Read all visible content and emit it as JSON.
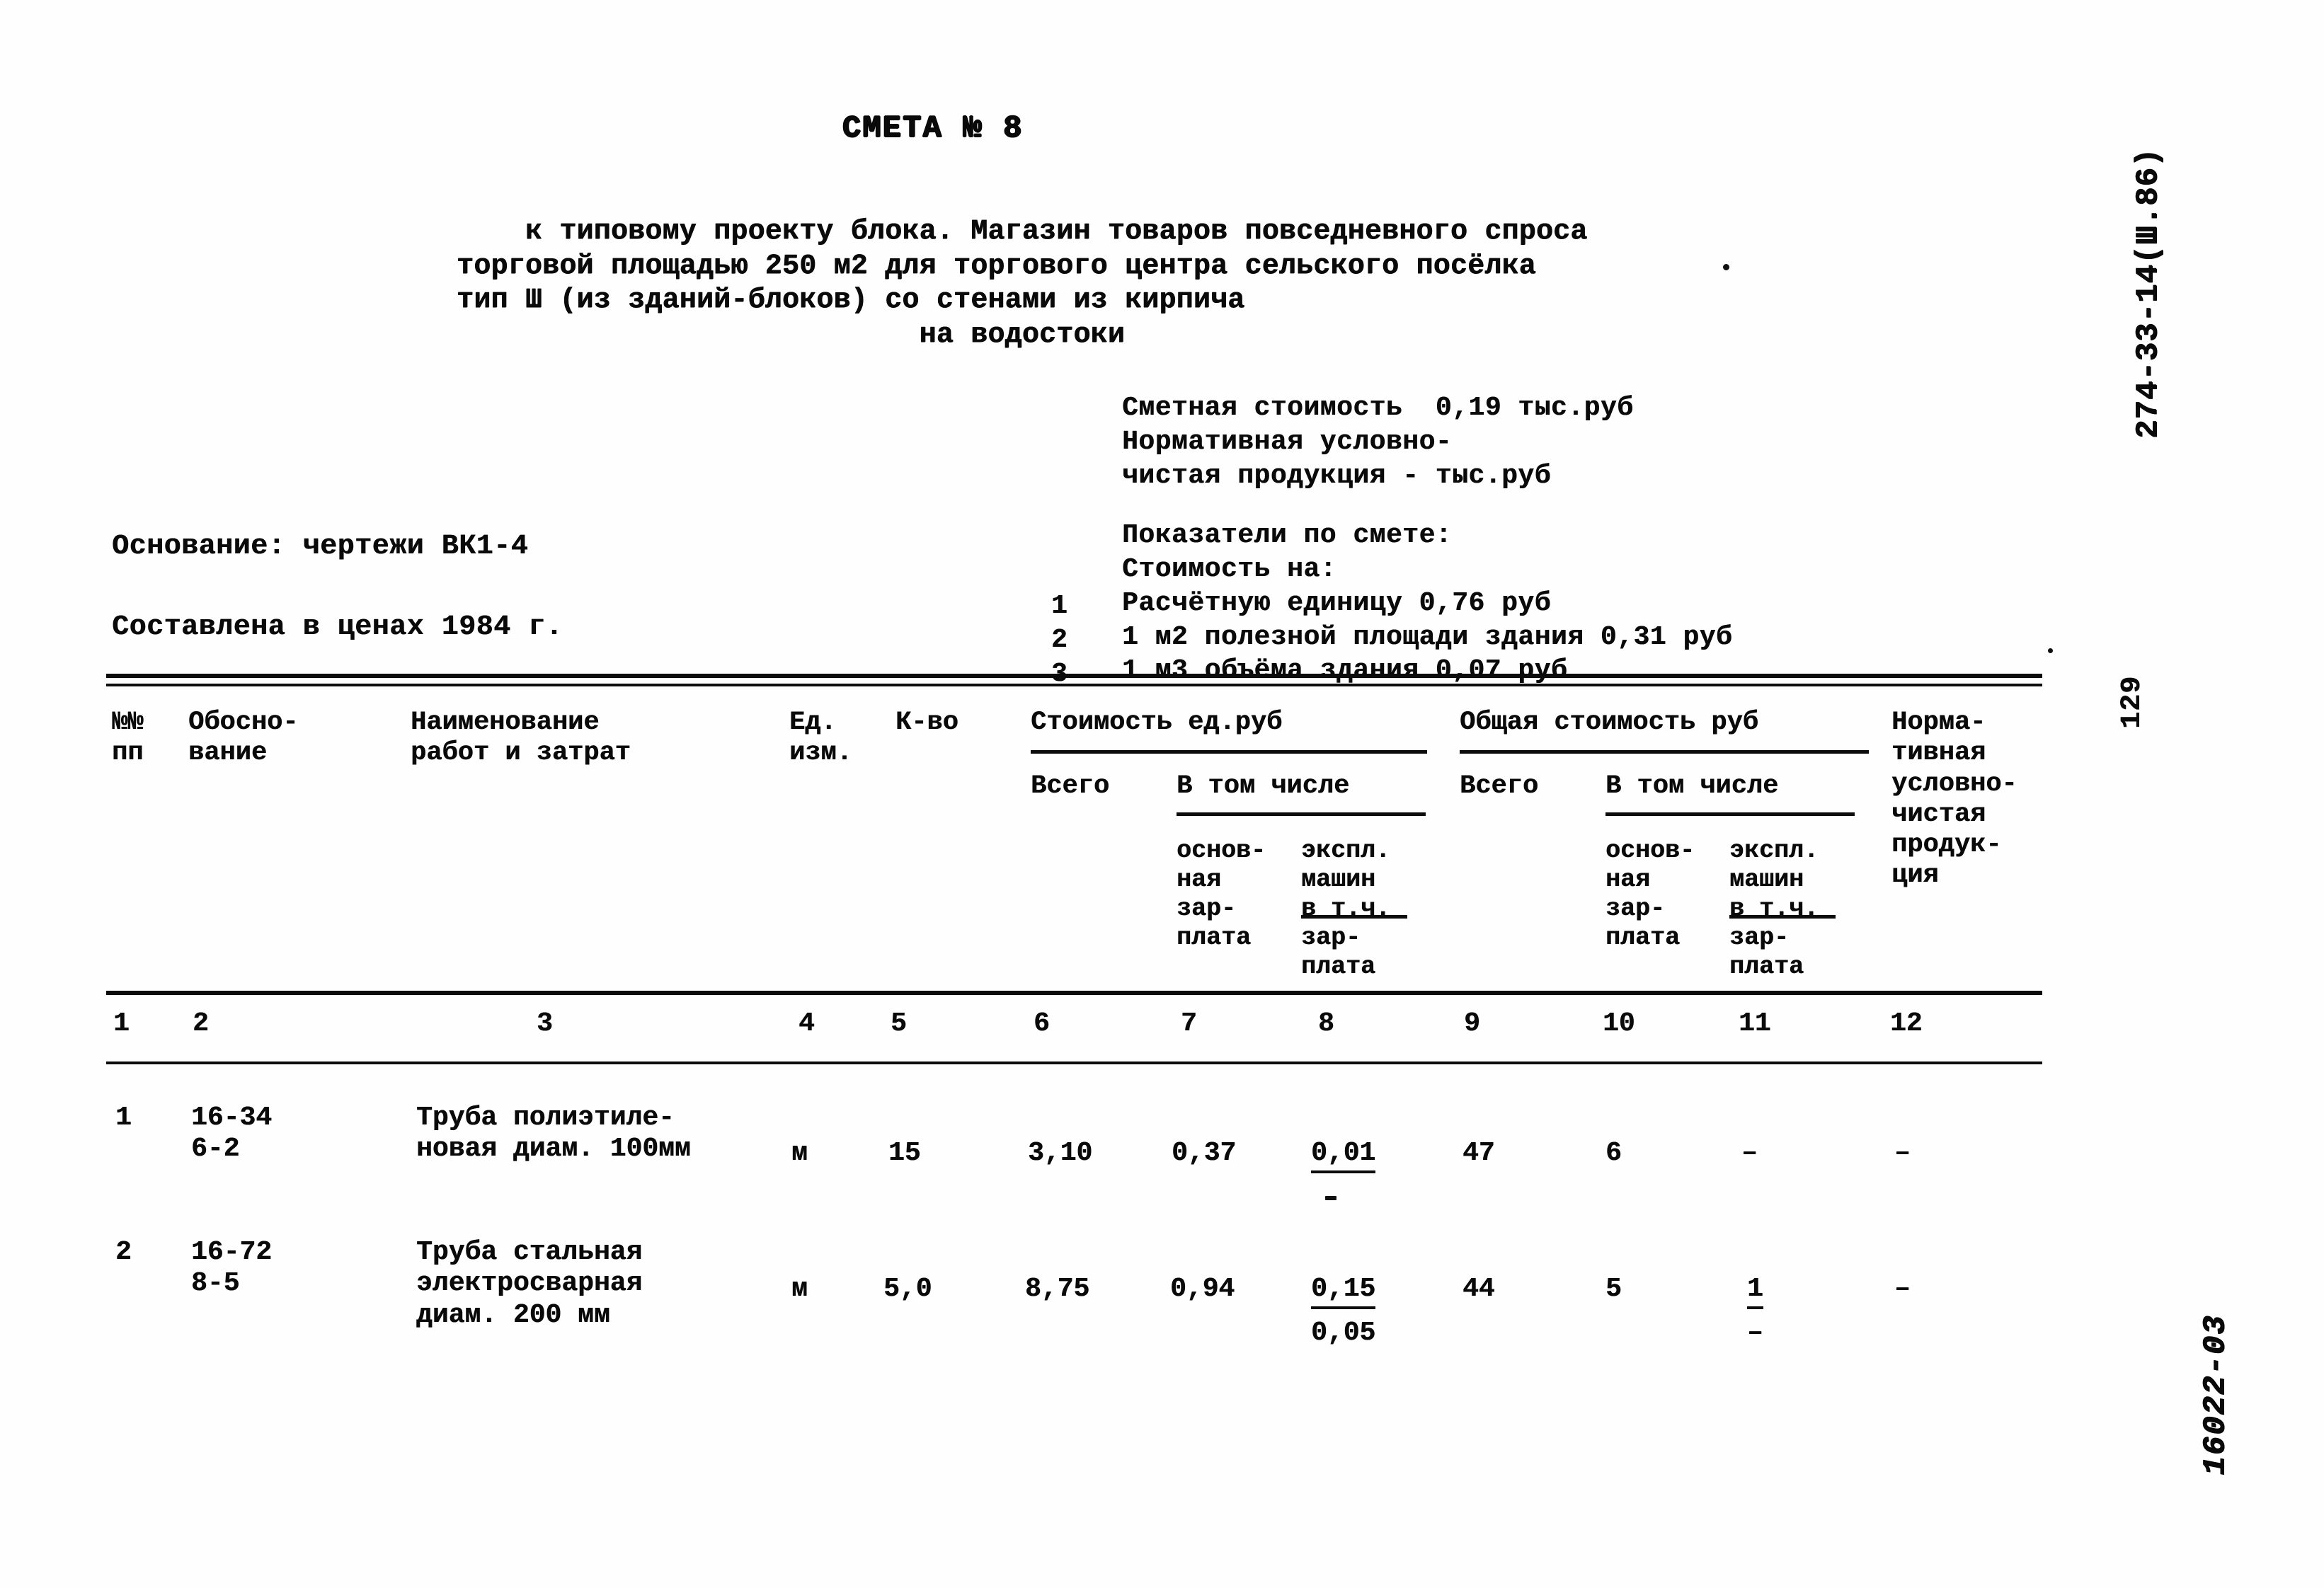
{
  "document": {
    "title": "СМЕТА № 8",
    "subtitle_lines": [
      "к типовому проекту блока. Магазин товаров повседневного спроса",
      "торговой площадью 250 м2 для торгового центра сельского посёлка",
      "тип Ш (из зданий-блоков) со стенами из кирпича"
    ],
    "subtitle_center": "на водостоки",
    "code_vertical": "274-33-14(Ш.86)",
    "page_number_vertical": "129",
    "archive_stamp_vertical": "16022-03"
  },
  "summary": {
    "estimate_cost_label": "Сметная стоимость",
    "estimate_cost_value": "0,19 тыс.руб",
    "npp_line1": "Нормативная условно-",
    "npp_line2": "чистая продукция - тыс.руб"
  },
  "indicators": {
    "heading": "Показатели по смете:",
    "subheading": "Стоимость на:",
    "items": [
      {
        "no": "1",
        "text": "Расчётную единицу 0,76 руб"
      },
      {
        "no": "2",
        "text": "1 м2 полезной площади здания 0,31 руб"
      },
      {
        "no": "3",
        "text": "1 м3 объёма здания 0,07 руб"
      }
    ]
  },
  "basis": {
    "line1": "Основание: чертежи ВК1-4",
    "line2": "Составлена в ценах 1984 г."
  },
  "table": {
    "header": {
      "col1_l1": "№№",
      "col1_l2": "пп",
      "col2_l1": "Обосно-",
      "col2_l2": "вание",
      "col3_l1": "Наименование",
      "col3_l2": "работ и затрат",
      "col4_l1": "Ед.",
      "col4_l2": "изм.",
      "col5": "К-во",
      "group_unit_cost": "Стоимость ед.руб",
      "group_total_cost": "Общая стоимость руб",
      "total_label_a": "Всего",
      "incl_label_a": "В том числе",
      "total_label_b": "Всего",
      "incl_label_b": "В том числе",
      "sub_basic_l1": "основ-",
      "sub_basic_l2": "ная",
      "sub_basic_l3": "зар-",
      "sub_basic_l4": "плата",
      "sub_mach_l1": "экспл.",
      "sub_mach_l2": "машин",
      "sub_mach_l3": "в т.ч.",
      "sub_mach_l4": "зар-",
      "sub_mach_l5": "плата",
      "col12_l1": "Норма-",
      "col12_l2": "тивная",
      "col12_l3": "условно-",
      "col12_l4": "чистая",
      "col12_l5": "продук-",
      "col12_l6": "ция"
    },
    "column_numbers": [
      "1",
      "2",
      "3",
      "4",
      "5",
      "6",
      "7",
      "8",
      "9",
      "10",
      "11",
      "12"
    ],
    "rows": [
      {
        "no": "1",
        "code_l1": "16-34",
        "code_l2": "6-2",
        "name_l1": "Труба полиэтиле-",
        "name_l2": "новая диам. 100мм",
        "name_l3": "",
        "unit": "м",
        "qty": "15",
        "unit_total": "3,10",
        "unit_basic_wage": "0,37",
        "unit_mach_top": "0,01",
        "unit_mach_bottom": "",
        "grand_total": "47",
        "grand_basic_wage": "6",
        "grand_mach_top": "–",
        "grand_mach_bottom": "",
        "npp": "–"
      },
      {
        "no": "2",
        "code_l1": "16-72",
        "code_l2": "8-5",
        "name_l1": "Труба стальная",
        "name_l2": "электросварная",
        "name_l3": "диам. 200 мм",
        "unit": "м",
        "qty": "5,0",
        "unit_total": "8,75",
        "unit_basic_wage": "0,94",
        "unit_mach_top": "0,15",
        "unit_mach_bottom": "0,05",
        "grand_total": "44",
        "grand_basic_wage": "5",
        "grand_mach_top": "1",
        "grand_mach_bottom": "–",
        "npp": "–"
      }
    ]
  }
}
